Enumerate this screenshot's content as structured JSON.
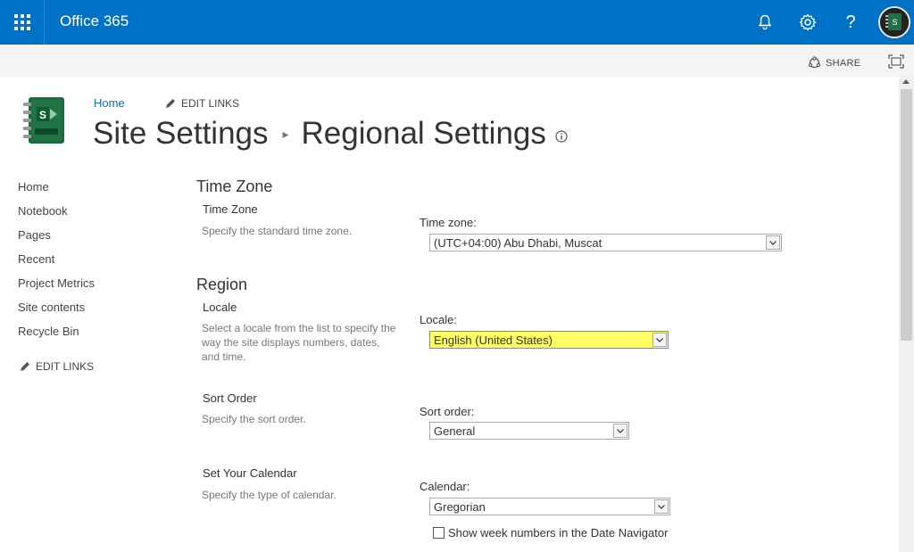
{
  "suite_bar": {
    "app_title": "Office 365",
    "icons": [
      "waffle-icon",
      "bell-icon",
      "gear-icon",
      "help-icon",
      "avatar"
    ],
    "color": "#0072c6"
  },
  "share_bar": {
    "share_label": "SHARE",
    "icons": [
      "share-icon",
      "focus-icon"
    ]
  },
  "top_nav": {
    "home": "Home",
    "edit_links": "EDIT LINKS"
  },
  "page_title": {
    "breadcrumb_parent": "Site Settings",
    "current": "Regional Settings"
  },
  "left_nav": {
    "items": [
      "Home",
      "Notebook",
      "Pages",
      "Recent",
      "Project Metrics",
      "Site contents",
      "Recycle Bin"
    ],
    "edit_links": "EDIT LINKS"
  },
  "time_zone_section": {
    "title": "Time Zone",
    "field_title": "Time Zone",
    "description": "Specify the standard time zone.",
    "label": "Time zone:",
    "value": "(UTC+04:00) Abu Dhabi, Muscat"
  },
  "region_section": {
    "title": "Region",
    "locale": {
      "field_title": "Locale",
      "description_lines": [
        "Select a locale from the list to specify the",
        "way the site displays numbers, dates,",
        "and time."
      ],
      "label": "Locale:",
      "value": "English (United States)",
      "highlight_color": "#ffff66"
    },
    "sort_order": {
      "field_title": "Sort Order",
      "description": "Specify the sort order.",
      "label": "Sort order:",
      "value": "General"
    },
    "calendar": {
      "field_title": "Set Your Calendar",
      "description": "Specify the type of calendar.",
      "label": "Calendar:",
      "value": "Gregorian",
      "week_numbers_label": "Show week numbers in the Date Navigator",
      "week_numbers_checked": false
    }
  }
}
